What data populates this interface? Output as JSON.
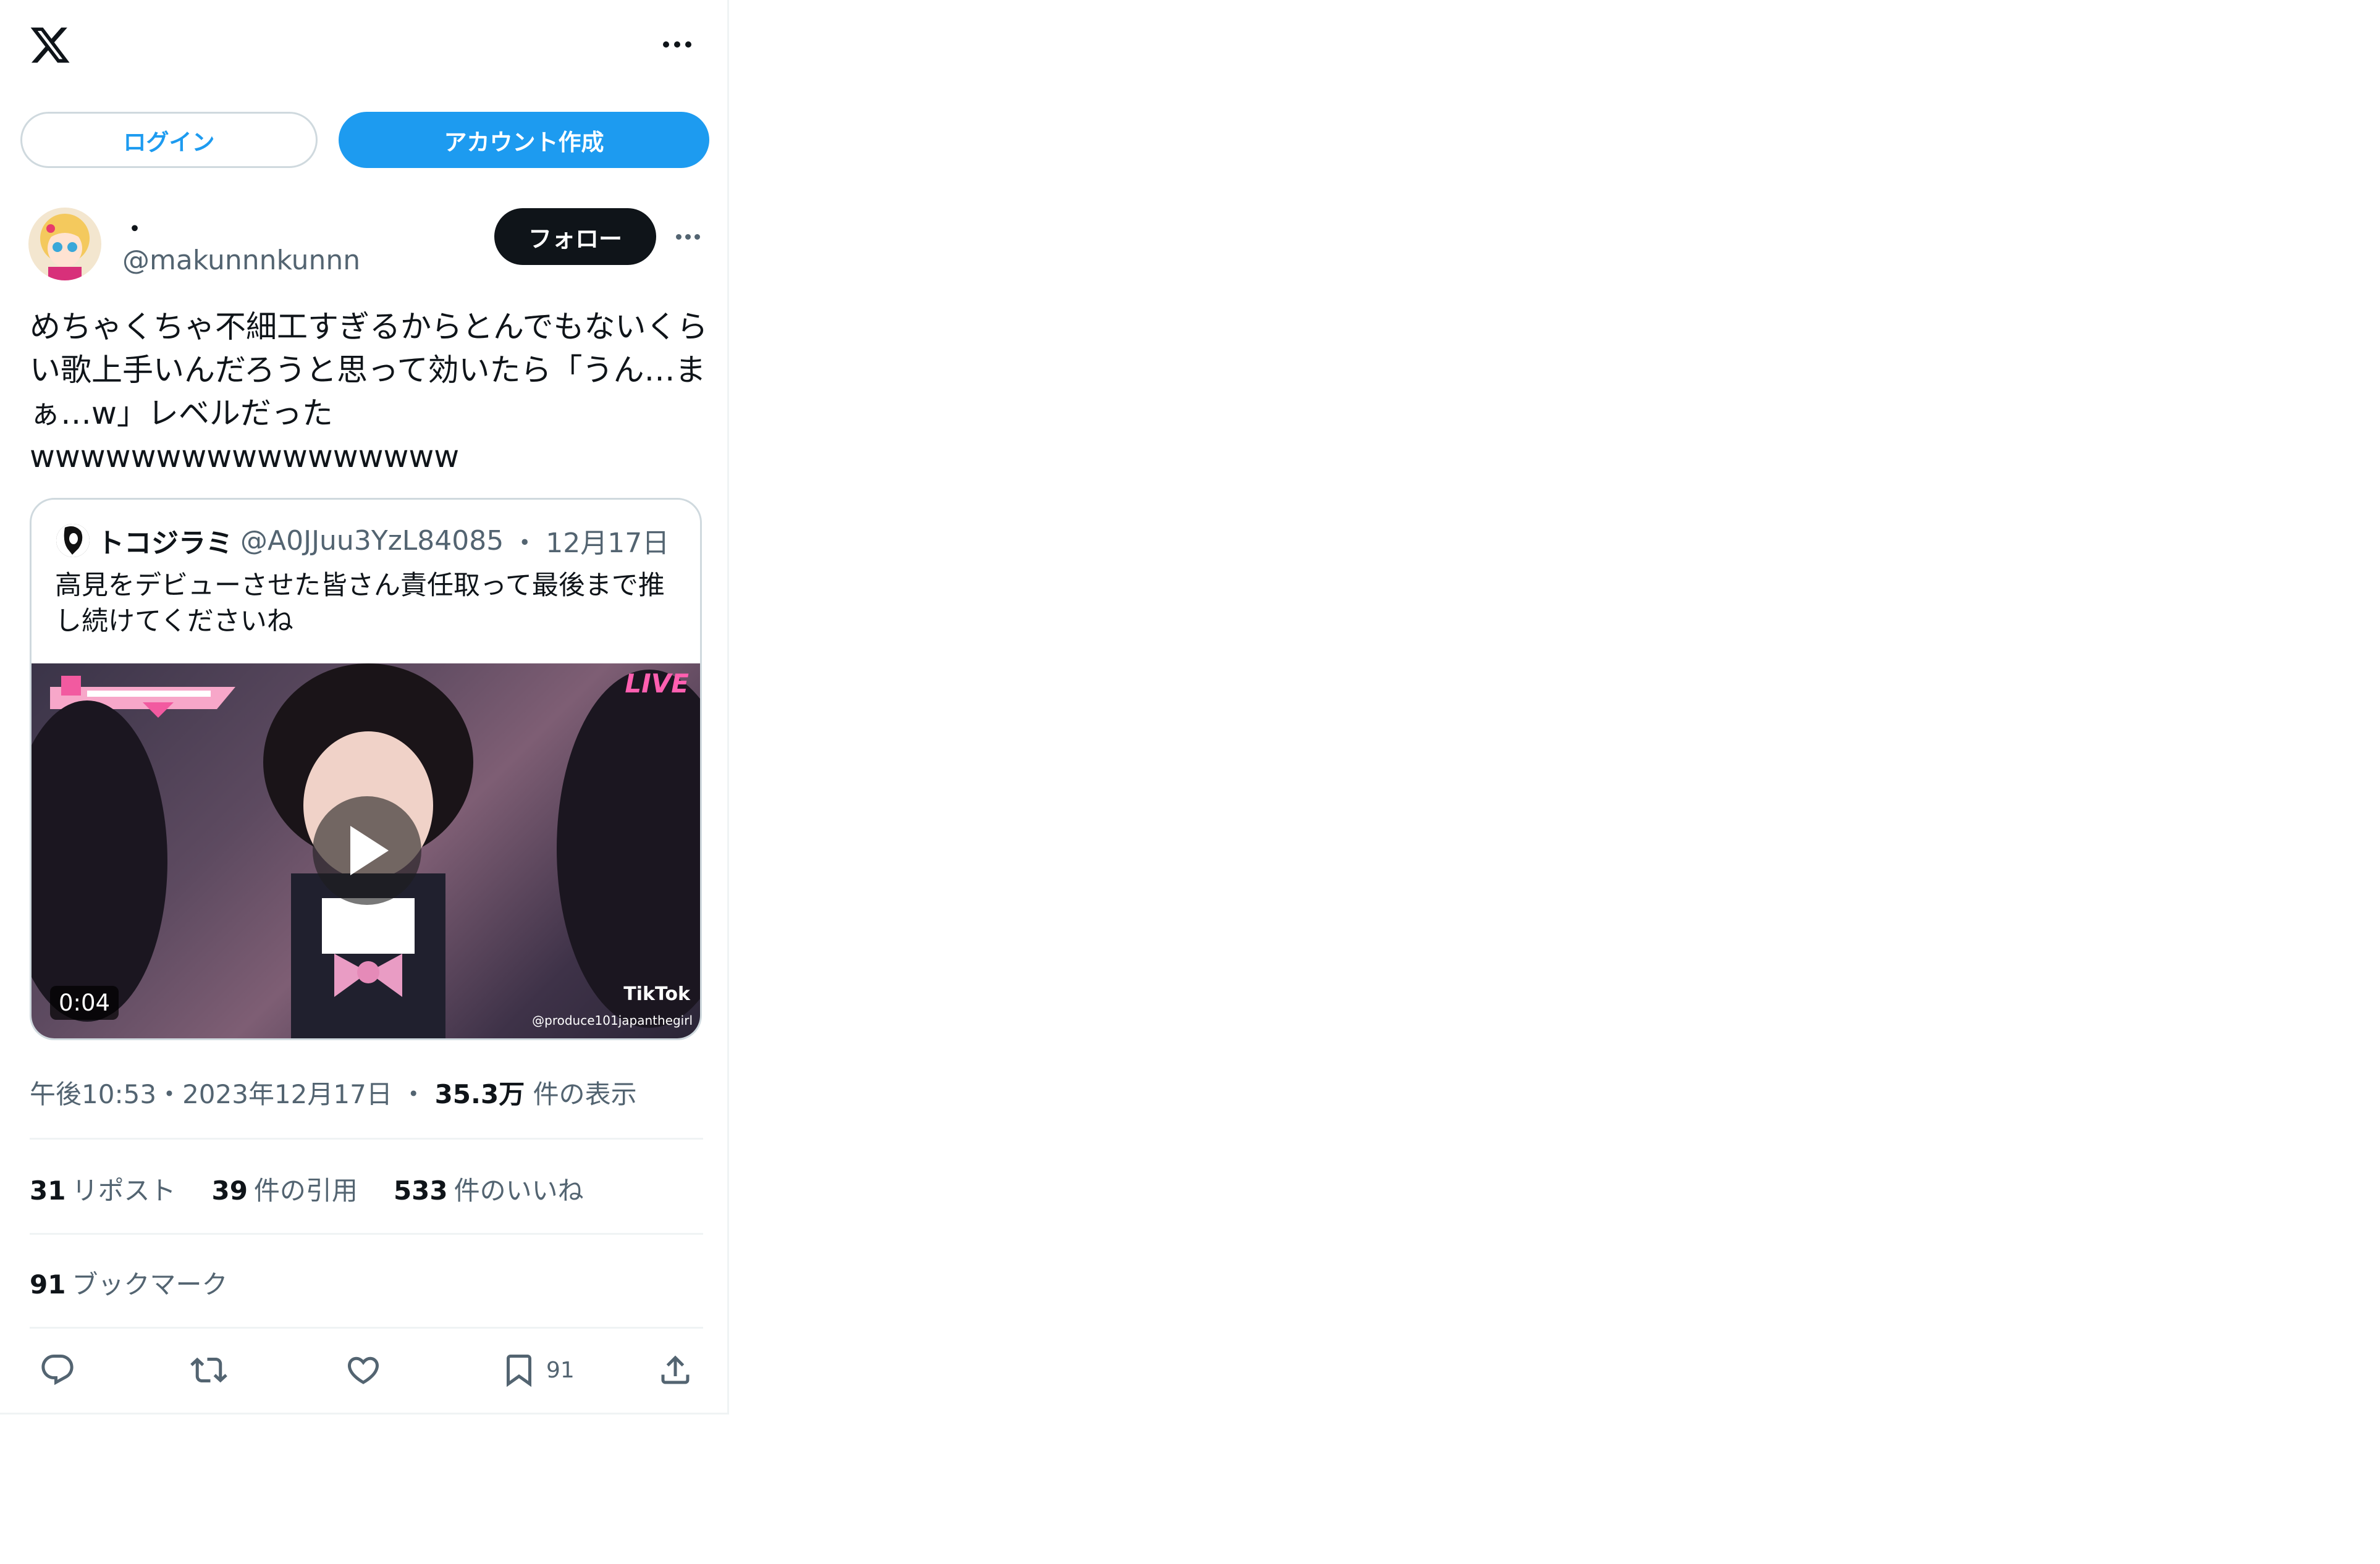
{
  "header": {
    "logo": "x-logo-icon",
    "more": "more-icon"
  },
  "auth": {
    "login_label": "ログイン",
    "signup_label": "アカウント作成"
  },
  "author": {
    "name": "・",
    "handle": "@makunnnkunnn",
    "follow_label": "フォロー"
  },
  "post": {
    "text": "めちゃくちゃ不細工すぎるからとんでもないくら\nい歌上手いんだろうと思って効いたら「うん…ま\nぁ…w」レベルだった\nwwwwwwwwwwwwwwwww"
  },
  "quote": {
    "name": "トコジラミ",
    "handle": "@A0JJuu3YzL84085",
    "separator": "・",
    "date": "12月17日",
    "text": "高見をデビューさせた皆さん責任取って最後まで推\nし続けてくださいね",
    "video": {
      "duration": "0:04",
      "live_badge": "LIVE",
      "watermark": "TikTok",
      "watermark_handle": "@produce101japanthegirl"
    }
  },
  "meta": {
    "time": "午後10:53",
    "sep1": "・",
    "date": "2023年12月17日",
    "sep2": "・",
    "views_count": "35.3万",
    "views_label": "件の表示"
  },
  "stats": {
    "reposts_count": "31",
    "reposts_label": "リポスト",
    "quotes_count": "39",
    "quotes_label": "件の引用",
    "likes_count": "533",
    "likes_label": "件のいいね",
    "bookmarks_count": "91",
    "bookmarks_label": "ブックマーク"
  },
  "actions": {
    "bookmark_count": "91"
  },
  "colors": {
    "accent": "#1d9bf0",
    "text": "#0f1419",
    "muted": "#536471",
    "border": "#cfd9de"
  }
}
